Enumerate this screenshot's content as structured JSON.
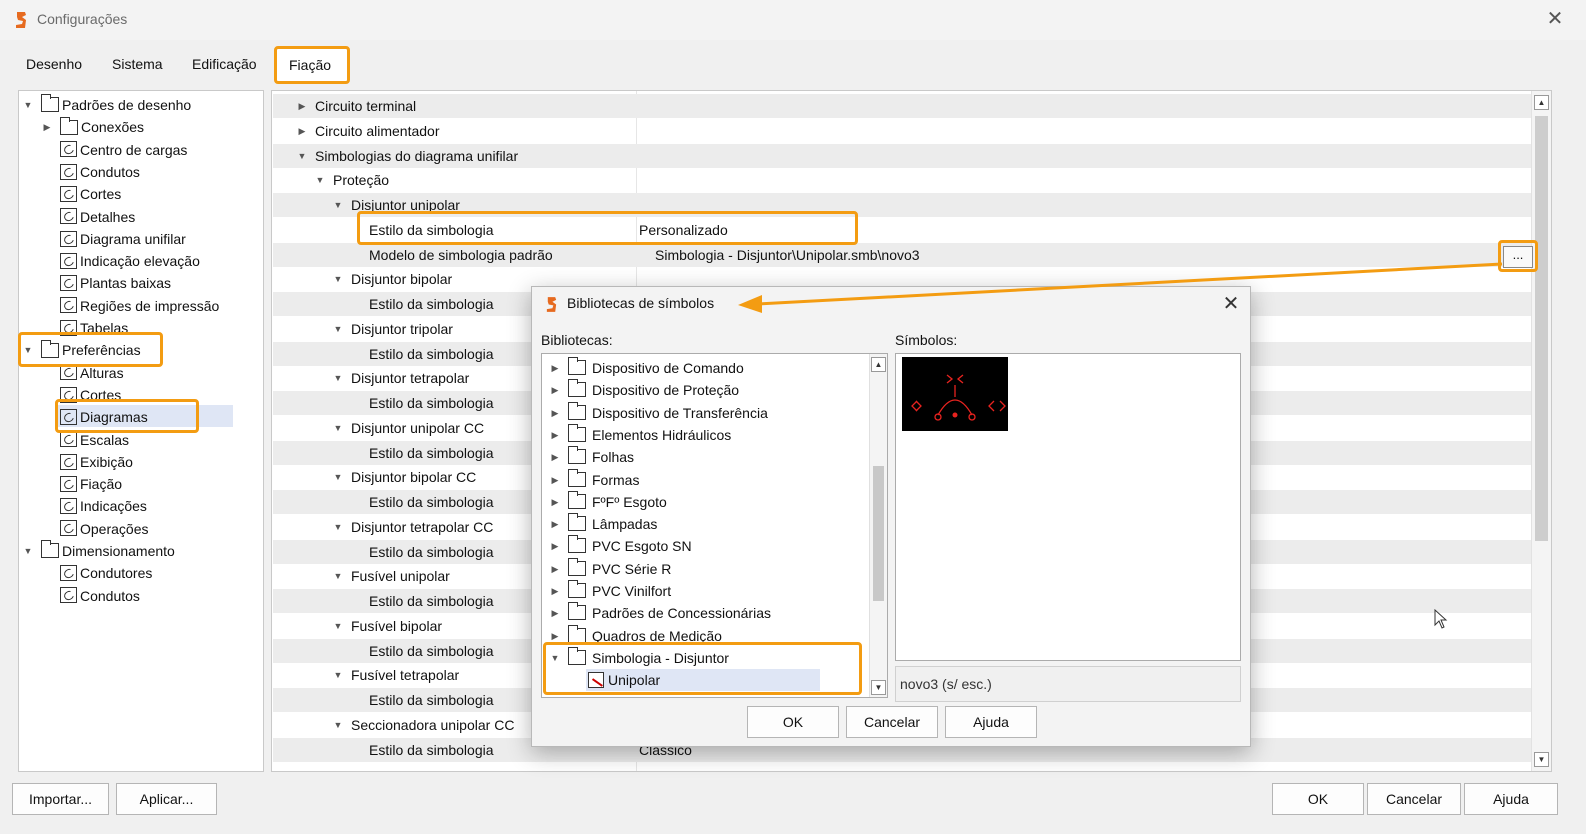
{
  "window": {
    "title": "Configurações"
  },
  "tabs": [
    "Desenho",
    "Sistema",
    "Edificação",
    "Fiação"
  ],
  "left_tree": [
    {
      "label": "Padrões de desenho",
      "level": 0,
      "icon": "folder-icon",
      "expander": "open"
    },
    {
      "label": "Conexões",
      "level": 1,
      "icon": "folder-icon",
      "expander": "closed"
    },
    {
      "label": "Centro de cargas",
      "level": 1,
      "icon": "settings-page-icon"
    },
    {
      "label": "Condutos",
      "level": 1,
      "icon": "settings-page-icon"
    },
    {
      "label": "Cortes",
      "level": 1,
      "icon": "settings-page-icon"
    },
    {
      "label": "Detalhes",
      "level": 1,
      "icon": "settings-page-icon"
    },
    {
      "label": "Diagrama unifilar",
      "level": 1,
      "icon": "settings-page-icon"
    },
    {
      "label": "Indicação elevação",
      "level": 1,
      "icon": "settings-page-icon"
    },
    {
      "label": "Plantas baixas",
      "level": 1,
      "icon": "settings-page-icon"
    },
    {
      "label": "Regiões de impressão",
      "level": 1,
      "icon": "settings-page-icon"
    },
    {
      "label": "Tabelas",
      "level": 1,
      "icon": "settings-page-icon"
    },
    {
      "label": "Preferências",
      "level": 0,
      "icon": "folder-icon",
      "expander": "open"
    },
    {
      "label": "Alturas",
      "level": 1,
      "icon": "settings-page-icon"
    },
    {
      "label": "Cortes",
      "level": 1,
      "icon": "settings-page-icon"
    },
    {
      "label": "Diagramas",
      "level": 1,
      "icon": "settings-page-icon"
    },
    {
      "label": "Escalas",
      "level": 1,
      "icon": "settings-page-icon"
    },
    {
      "label": "Exibição",
      "level": 1,
      "icon": "settings-page-icon"
    },
    {
      "label": "Fiação",
      "level": 1,
      "icon": "settings-page-icon"
    },
    {
      "label": "Indicações",
      "level": 1,
      "icon": "settings-page-icon"
    },
    {
      "label": "Operações",
      "level": 1,
      "icon": "settings-page-icon"
    },
    {
      "label": "Dimensionamento",
      "level": 0,
      "icon": "folder-icon",
      "expander": "open"
    },
    {
      "label": "Condutores",
      "level": 1,
      "icon": "settings-page-icon"
    },
    {
      "label": "Condutos",
      "level": 1,
      "icon": "settings-page-icon"
    }
  ],
  "properties": [
    {
      "name": "Circuito terminal",
      "level": 0,
      "expander": "closed",
      "value": ""
    },
    {
      "name": "Circuito alimentador",
      "level": 0,
      "expander": "closed",
      "value": ""
    },
    {
      "name": "Simbologias do diagrama unifilar",
      "level": 0,
      "expander": "open",
      "value": ""
    },
    {
      "name": "Proteção",
      "level": 1,
      "expander": "open",
      "value": ""
    },
    {
      "name": "Disjuntor unipolar",
      "level": 2,
      "expander": "open",
      "value": ""
    },
    {
      "name": "Estilo da simbologia",
      "level": 3,
      "value": "Personalizado"
    },
    {
      "name": "Modelo de simbologia padrão",
      "level": 3,
      "value": "Simbologia - Disjuntor\\Unipolar.smb\\novo3"
    },
    {
      "name": "Disjuntor bipolar",
      "level": 2,
      "expander": "open",
      "value": ""
    },
    {
      "name": "Estilo da simbologia",
      "level": 3,
      "value": ""
    },
    {
      "name": "Disjuntor tripolar",
      "level": 2,
      "expander": "open",
      "value": ""
    },
    {
      "name": "Estilo da simbologia",
      "level": 3,
      "value": ""
    },
    {
      "name": "Disjuntor tetrapolar",
      "level": 2,
      "expander": "open",
      "value": ""
    },
    {
      "name": "Estilo da simbologia",
      "level": 3,
      "value": ""
    },
    {
      "name": "Disjuntor unipolar CC",
      "level": 2,
      "expander": "open",
      "value": ""
    },
    {
      "name": "Estilo da simbologia",
      "level": 3,
      "value": ""
    },
    {
      "name": "Disjuntor bipolar CC",
      "level": 2,
      "expander": "open",
      "value": ""
    },
    {
      "name": "Estilo da simbologia",
      "level": 3,
      "value": ""
    },
    {
      "name": "Disjuntor tetrapolar CC",
      "level": 2,
      "expander": "open",
      "value": ""
    },
    {
      "name": "Estilo da simbologia",
      "level": 3,
      "value": ""
    },
    {
      "name": "Fusível unipolar",
      "level": 2,
      "expander": "open",
      "value": ""
    },
    {
      "name": "Estilo da simbologia",
      "level": 3,
      "value": ""
    },
    {
      "name": "Fusível bipolar",
      "level": 2,
      "expander": "open",
      "value": ""
    },
    {
      "name": "Estilo da simbologia",
      "level": 3,
      "value": ""
    },
    {
      "name": "Fusível tetrapolar",
      "level": 2,
      "expander": "open",
      "value": ""
    },
    {
      "name": "Estilo da simbologia",
      "level": 3,
      "value": ""
    },
    {
      "name": "Seccionadora unipolar CC",
      "level": 2,
      "expander": "open",
      "value": ""
    },
    {
      "name": "Estilo da simbologia",
      "level": 3,
      "value": "Clássico"
    }
  ],
  "ellipsis_label": "...",
  "bottom_left_buttons": [
    "Importar...",
    "Aplicar..."
  ],
  "bottom_right_buttons": [
    "OK",
    "Cancelar",
    "Ajuda"
  ],
  "dialog": {
    "title": "Bibliotecas de símbolos",
    "libraries_label": "Bibliotecas:",
    "symbols_label": "Símbolos:",
    "libraries": [
      {
        "label": "Dispositivo de Comando",
        "expander": "closed"
      },
      {
        "label": "Dispositivo de Proteção",
        "expander": "closed"
      },
      {
        "label": "Dispositivo de Transferência",
        "expander": "closed"
      },
      {
        "label": "Elementos Hidráulicos",
        "expander": "closed"
      },
      {
        "label": "Folhas",
        "expander": "closed"
      },
      {
        "label": "Formas",
        "expander": "closed"
      },
      {
        "label": "FºFº Esgoto",
        "expander": "closed"
      },
      {
        "label": "Lâmpadas",
        "expander": "closed"
      },
      {
        "label": "PVC Esgoto SN",
        "expander": "closed"
      },
      {
        "label": "PVC Série R",
        "expander": "closed"
      },
      {
        "label": "PVC Vinilfort",
        "expander": "closed"
      },
      {
        "label": "Padrões de Concessionárias",
        "expander": "closed"
      },
      {
        "label": "Quadros de Medição",
        "expander": "closed"
      },
      {
        "label": "Simbologia - Disjuntor",
        "expander": "open"
      },
      {
        "label": "Unipolar",
        "child": true,
        "selected": true
      }
    ],
    "symbol_name": "novo3 (s/ esc.)",
    "buttons": [
      "OK",
      "Cancelar",
      "Ajuda"
    ]
  },
  "colors": {
    "highlight": "#f39c12",
    "selection": "#dfe6f5",
    "symbol_red": "#e8231f",
    "app_icon": "#e66a1f"
  }
}
